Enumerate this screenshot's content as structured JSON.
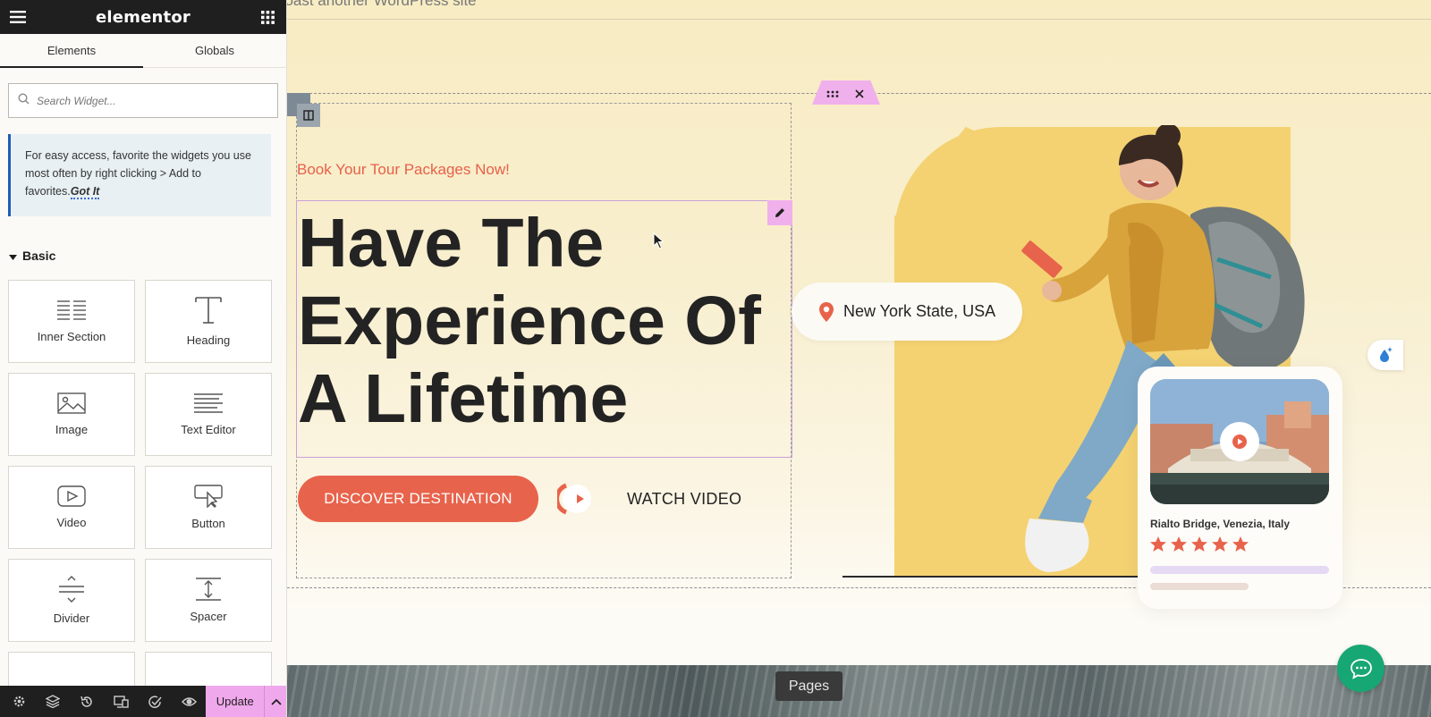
{
  "app": {
    "logo": "elementor"
  },
  "sidebar": {
    "tabs": [
      {
        "label": "Elements"
      },
      {
        "label": "Globals"
      }
    ],
    "search_placeholder": "Search Widget...",
    "tip": {
      "text": "For easy access, favorite the widgets you use most often by right clicking > Add to favorites.",
      "action": "Got It"
    },
    "section": "Basic",
    "widgets": [
      {
        "label": "Inner Section",
        "icon": "inner-section-icon"
      },
      {
        "label": "Heading",
        "icon": "heading-icon"
      },
      {
        "label": "Image",
        "icon": "image-icon"
      },
      {
        "label": "Text Editor",
        "icon": "text-editor-icon"
      },
      {
        "label": "Video",
        "icon": "video-icon"
      },
      {
        "label": "Button",
        "icon": "button-icon"
      },
      {
        "label": "Divider",
        "icon": "divider-icon"
      },
      {
        "label": "Spacer",
        "icon": "spacer-icon"
      }
    ],
    "bottom": {
      "update_label": "Update"
    }
  },
  "canvas": {
    "top_text": "boast another WordPress site",
    "subheading": "Book Your Tour Packages Now!",
    "hero_lines": [
      "Have The",
      "Experience Of",
      "A Lifetime"
    ],
    "discover_label": "DISCOVER DESTINATION",
    "watch_label": "WATCH VIDEO",
    "location": "New York State, USA",
    "card": {
      "title": "Rialto Bridge, Venezia, Italy",
      "rating": 5
    },
    "pages_label": "Pages"
  },
  "colors": {
    "accent": "#e8634b",
    "editor_pink": "#f0b0ec",
    "blob_yellow": "#f4d272",
    "chat_green": "#17a774",
    "dark": "#1f1f1f"
  }
}
